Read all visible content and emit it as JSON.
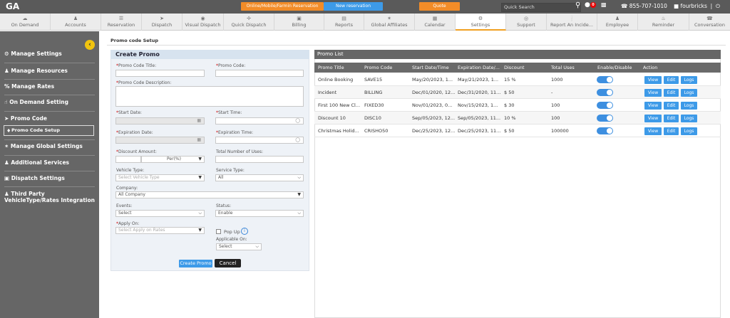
{
  "topbar": {
    "logo": "GA",
    "btn_online": "Online/Mobile/Farmin Reservation",
    "btn_new": "New reservation",
    "btn_quote": "Quote",
    "quick_search": "Quick Search",
    "notif_count": "0",
    "phone": "855-707-1010",
    "user": "fourbricks",
    "colors": {
      "online": "#f28c28",
      "new": "#3d9ae8",
      "quote": "#f28c28"
    }
  },
  "nav": [
    {
      "label": "On Demand",
      "icon": "cloud-icon"
    },
    {
      "label": "Accounts",
      "icon": "user-icon"
    },
    {
      "label": "Reservation",
      "icon": "list-icon"
    },
    {
      "label": "Dispatch",
      "icon": "send-icon"
    },
    {
      "label": "Visual Dispatch",
      "icon": "eye-icon"
    },
    {
      "label": "Quick Dispatch",
      "icon": "flash-icon"
    },
    {
      "label": "Billing",
      "icon": "billing-icon"
    },
    {
      "label": "Reports",
      "icon": "report-icon"
    },
    {
      "label": "Global Affiliates",
      "icon": "globe-icon"
    },
    {
      "label": "Calendar",
      "icon": "calendar-icon"
    },
    {
      "label": "Settings",
      "icon": "gear-icon"
    },
    {
      "label": "Support",
      "icon": "support-icon"
    },
    {
      "label": "Report An Incide...",
      "icon": "alert-icon"
    },
    {
      "label": "Employee",
      "icon": "employee-icon"
    },
    {
      "label": "Reminder",
      "icon": "bell-icon"
    },
    {
      "label": "Conversation",
      "icon": "chat-icon"
    }
  ],
  "sidebar": {
    "items": [
      "Manage Settings",
      "Manage Resources",
      "Manage Rates",
      "On Demand Setting",
      "Promo Code",
      "Manage Global Settings",
      "Additional Services",
      "Dispatch Settings",
      "Third Party VehicleType/Rates Integration"
    ],
    "sub_item": "Promo Code Setup"
  },
  "breadcrumb": "Promo code Setup",
  "form": {
    "title": "Create Promo",
    "title_label": "Promo Code Title:",
    "code_label": "Promo Code:",
    "desc_label": "Promo Code Description:",
    "start_date_label": "Start Date:",
    "start_time_label": "Start Time:",
    "exp_date_label": "Expiration Date:",
    "exp_time_label": "Expiration Time:",
    "discount_label": "Discount Amount:",
    "discount_type": "Per(%)",
    "uses_label": "Total Number of Uses:",
    "vehicle_label": "Vehicle Type:",
    "vehicle_placeholder": "Select Vehicle Type",
    "service_label": "Service Type:",
    "service_value": "All",
    "company_label": "Company:",
    "company_value": "All Company",
    "events_label": "Events:",
    "events_value": "Select",
    "status_label": "Status:",
    "status_value": "Enable",
    "apply_label": "Apply On:",
    "apply_placeholder": "Select Apply on Rates",
    "popup_label": "Pop Up",
    "applicable_label": "Applicable On:",
    "applicable_value": "Select",
    "create_btn": "Create Promo",
    "cancel_btn": "Cancel"
  },
  "promo_list": {
    "title": "Promo List",
    "columns": [
      "Promo Title",
      "Promo Code",
      "Start Date/Time",
      "Expiration Date/...",
      "Discount",
      "Total Uses",
      "Enable/Disable",
      "Action"
    ],
    "rows": [
      {
        "title": "Online Booking",
        "code": "SAVE15",
        "start": "May/20/2023, 1...",
        "exp": "May/21/2023, 1...",
        "discount": "15 %",
        "uses": "1000"
      },
      {
        "title": "Incident",
        "code": "BILLING",
        "start": "Dec/01/2020, 12...",
        "exp": "Dec/31/2020, 11...",
        "discount": "$ 50",
        "uses": "-"
      },
      {
        "title": "First 100 New Cl...",
        "code": "FIXED30",
        "start": "Nov/01/2023, 0...",
        "exp": "Nov/15/2023, 1...",
        "discount": "$ 30",
        "uses": "100"
      },
      {
        "title": "Discount 10",
        "code": "DISC10",
        "start": "Sep/05/2023, 12...",
        "exp": "Sep/05/2023, 11...",
        "discount": "10 %",
        "uses": "100"
      },
      {
        "title": "Christmas Holid...",
        "code": "CRISHO50",
        "start": "Dec/25/2023, 12...",
        "exp": "Dec/25/2023, 11...",
        "discount": "$ 50",
        "uses": "100000"
      }
    ],
    "actions": [
      "View",
      "Edit",
      "Logs"
    ]
  }
}
